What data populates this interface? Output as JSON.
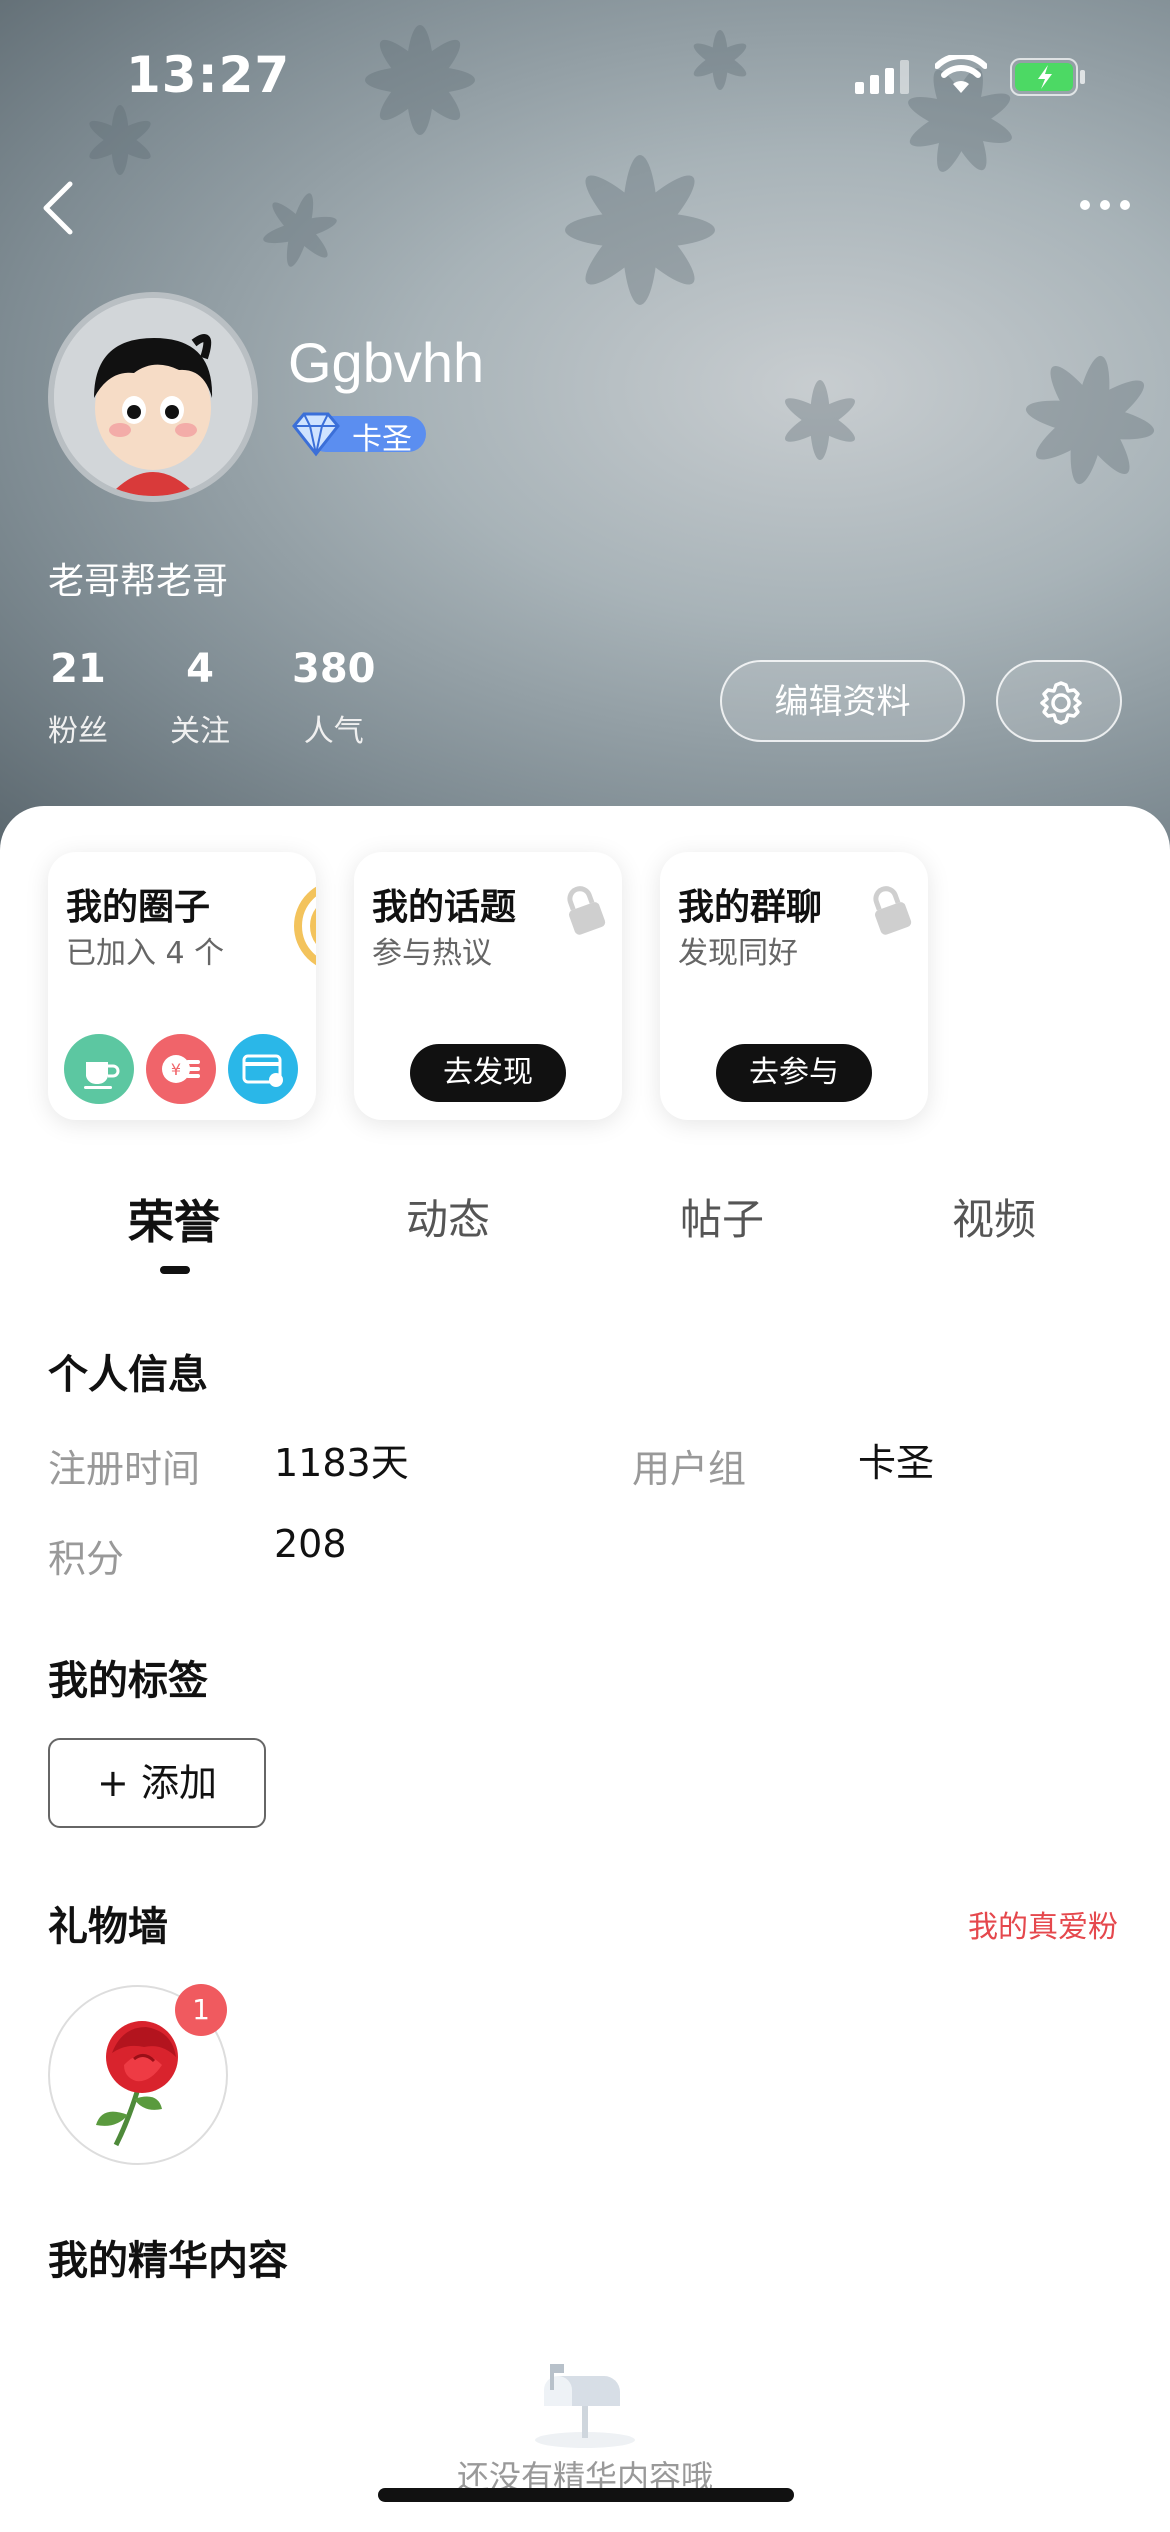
{
  "status_bar": {
    "time": "13:27"
  },
  "profile": {
    "username": "Ggbvhh",
    "badge": "卡圣",
    "bio": "老哥帮老哥",
    "stats": [
      {
        "value": "21",
        "label": "粉丝"
      },
      {
        "value": "4",
        "label": "关注"
      },
      {
        "value": "380",
        "label": "人气"
      }
    ],
    "edit_button": "编辑资料"
  },
  "cards": [
    {
      "title": "我的圈子",
      "subtitle": "已加入 4 个"
    },
    {
      "title": "我的话题",
      "subtitle": "参与热议",
      "button": "去发现"
    },
    {
      "title": "我的群聊",
      "subtitle": "发现同好",
      "button": "去参与"
    }
  ],
  "tabs": [
    "荣誉",
    "动态",
    "帖子",
    "视频"
  ],
  "personal_info": {
    "title": "个人信息",
    "register_label": "注册时间",
    "register_value": "1183天",
    "group_label": "用户组",
    "group_value": "卡圣",
    "points_label": "积分",
    "points_value": "208"
  },
  "tags": {
    "title": "我的标签",
    "add_label": "+ 添加"
  },
  "gift_wall": {
    "title": "礼物墙",
    "link": "我的真爱粉",
    "gift_count": "1"
  },
  "featured": {
    "title": "我的精华内容",
    "empty_text": "还没有精华内容哦"
  },
  "colors": {
    "accent_red": "#e5484d",
    "dark": "#111111"
  }
}
